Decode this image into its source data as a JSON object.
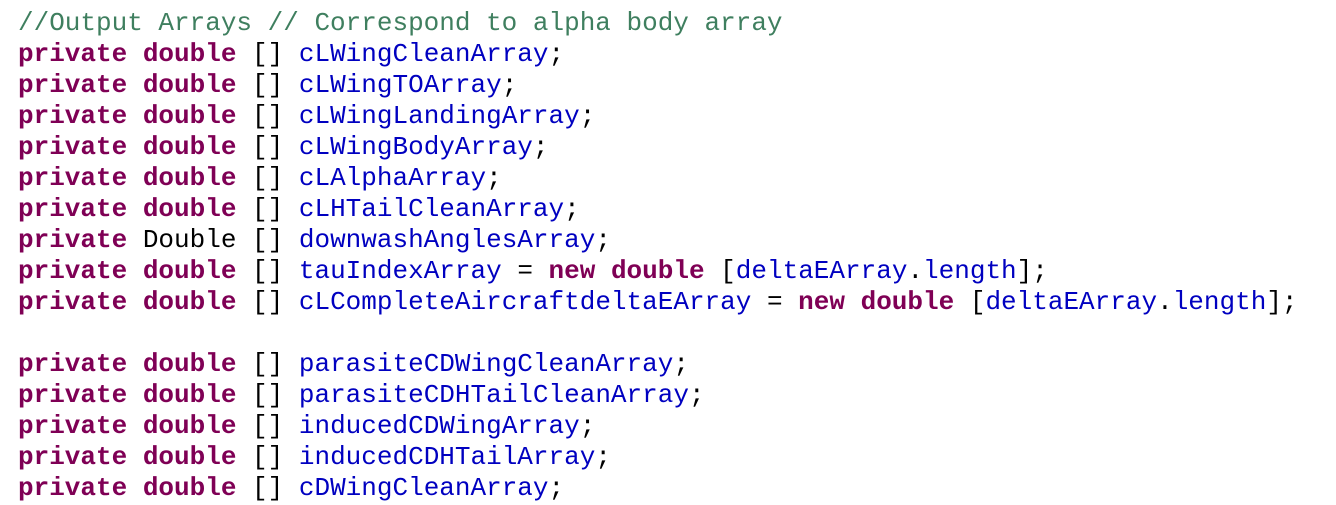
{
  "editor": {
    "lines": [
      [
        {
          "t": "//Output Arrays // Correspond to alpha body array",
          "k": "comment",
          "n": "code-comment"
        }
      ],
      [
        {
          "t": "private",
          "k": "keyword",
          "n": "keyword-private"
        },
        {
          "t": " "
        },
        {
          "t": "double",
          "k": "keyword",
          "n": "keyword-double"
        },
        {
          "t": " [] "
        },
        {
          "t": "cLWingCleanArray",
          "k": "ident",
          "n": "field-name"
        },
        {
          "t": ";"
        }
      ],
      [
        {
          "t": "private",
          "k": "keyword",
          "n": "keyword-private"
        },
        {
          "t": " "
        },
        {
          "t": "double",
          "k": "keyword",
          "n": "keyword-double"
        },
        {
          "t": " [] "
        },
        {
          "t": "cLWingTOArray",
          "k": "ident",
          "n": "field-name"
        },
        {
          "t": ";"
        }
      ],
      [
        {
          "t": "private",
          "k": "keyword",
          "n": "keyword-private"
        },
        {
          "t": " "
        },
        {
          "t": "double",
          "k": "keyword",
          "n": "keyword-double"
        },
        {
          "t": " [] "
        },
        {
          "t": "cLWingLandingArray",
          "k": "ident",
          "n": "field-name"
        },
        {
          "t": ";"
        }
      ],
      [
        {
          "t": "private",
          "k": "keyword",
          "n": "keyword-private"
        },
        {
          "t": " "
        },
        {
          "t": "double",
          "k": "keyword",
          "n": "keyword-double"
        },
        {
          "t": " [] "
        },
        {
          "t": "cLWingBodyArray",
          "k": "ident",
          "n": "field-name"
        },
        {
          "t": ";"
        }
      ],
      [
        {
          "t": "private",
          "k": "keyword",
          "n": "keyword-private"
        },
        {
          "t": " "
        },
        {
          "t": "double",
          "k": "keyword",
          "n": "keyword-double"
        },
        {
          "t": " [] "
        },
        {
          "t": "cLAlphaArray",
          "k": "ident",
          "n": "field-name"
        },
        {
          "t": ";"
        }
      ],
      [
        {
          "t": "private",
          "k": "keyword",
          "n": "keyword-private"
        },
        {
          "t": " "
        },
        {
          "t": "double",
          "k": "keyword",
          "n": "keyword-double"
        },
        {
          "t": " [] "
        },
        {
          "t": "cLHTailCleanArray",
          "k": "ident",
          "n": "field-name"
        },
        {
          "t": ";"
        }
      ],
      [
        {
          "t": "private",
          "k": "keyword",
          "n": "keyword-private"
        },
        {
          "t": " Double [] "
        },
        {
          "t": "downwashAnglesArray",
          "k": "ident",
          "n": "field-name"
        },
        {
          "t": ";"
        }
      ],
      [
        {
          "t": "private",
          "k": "keyword",
          "n": "keyword-private"
        },
        {
          "t": " "
        },
        {
          "t": "double",
          "k": "keyword",
          "n": "keyword-double"
        },
        {
          "t": " [] "
        },
        {
          "t": "tauIndexArray",
          "k": "ident",
          "n": "field-name"
        },
        {
          "t": " = "
        },
        {
          "t": "new",
          "k": "keyword",
          "n": "keyword-new"
        },
        {
          "t": " "
        },
        {
          "t": "double",
          "k": "keyword",
          "n": "keyword-double"
        },
        {
          "t": " ["
        },
        {
          "t": "deltaEArray",
          "k": "ident",
          "n": "field-name"
        },
        {
          "t": "."
        },
        {
          "t": "length",
          "k": "ident",
          "n": "field-name"
        },
        {
          "t": "];"
        }
      ],
      [
        {
          "t": "private",
          "k": "keyword",
          "n": "keyword-private"
        },
        {
          "t": " "
        },
        {
          "t": "double",
          "k": "keyword",
          "n": "keyword-double"
        },
        {
          "t": " [] "
        },
        {
          "t": "cLCompleteAircraftdeltaEArray",
          "k": "ident",
          "n": "field-name"
        },
        {
          "t": " = "
        },
        {
          "t": "new",
          "k": "keyword",
          "n": "keyword-new"
        },
        {
          "t": " "
        },
        {
          "t": "double",
          "k": "keyword",
          "n": "keyword-double"
        },
        {
          "t": " ["
        },
        {
          "t": "deltaEArray",
          "k": "ident",
          "n": "field-name"
        },
        {
          "t": "."
        },
        {
          "t": "length",
          "k": "ident",
          "n": "field-name"
        },
        {
          "t": "];"
        }
      ],
      [],
      [
        {
          "t": "private",
          "k": "keyword",
          "n": "keyword-private"
        },
        {
          "t": " "
        },
        {
          "t": "double",
          "k": "keyword",
          "n": "keyword-double"
        },
        {
          "t": " [] "
        },
        {
          "t": "parasiteCDWingCleanArray",
          "k": "ident",
          "n": "field-name"
        },
        {
          "t": ";"
        }
      ],
      [
        {
          "t": "private",
          "k": "keyword",
          "n": "keyword-private"
        },
        {
          "t": " "
        },
        {
          "t": "double",
          "k": "keyword",
          "n": "keyword-double"
        },
        {
          "t": " [] "
        },
        {
          "t": "parasiteCDHTailCleanArray",
          "k": "ident",
          "n": "field-name"
        },
        {
          "t": ";"
        }
      ],
      [
        {
          "t": "private",
          "k": "keyword",
          "n": "keyword-private"
        },
        {
          "t": " "
        },
        {
          "t": "double",
          "k": "keyword",
          "n": "keyword-double"
        },
        {
          "t": " [] "
        },
        {
          "t": "inducedCDWingArray",
          "k": "ident",
          "n": "field-name"
        },
        {
          "t": ";"
        }
      ],
      [
        {
          "t": "private",
          "k": "keyword",
          "n": "keyword-private"
        },
        {
          "t": " "
        },
        {
          "t": "double",
          "k": "keyword",
          "n": "keyword-double"
        },
        {
          "t": " [] "
        },
        {
          "t": "inducedCDHTailArray",
          "k": "ident",
          "n": "field-name"
        },
        {
          "t": ";"
        }
      ],
      [
        {
          "t": "private",
          "k": "keyword",
          "n": "keyword-private"
        },
        {
          "t": " "
        },
        {
          "t": "double",
          "k": "keyword",
          "n": "keyword-double"
        },
        {
          "t": " [] "
        },
        {
          "t": "cDWingCleanArray",
          "k": "ident",
          "n": "field-name"
        },
        {
          "t": ";"
        }
      ]
    ]
  },
  "colors": {
    "background": "#ffffff",
    "comment": "#3f7f5f",
    "keyword": "#7f0055",
    "identifier": "#0000c0",
    "plain": "#000000"
  }
}
